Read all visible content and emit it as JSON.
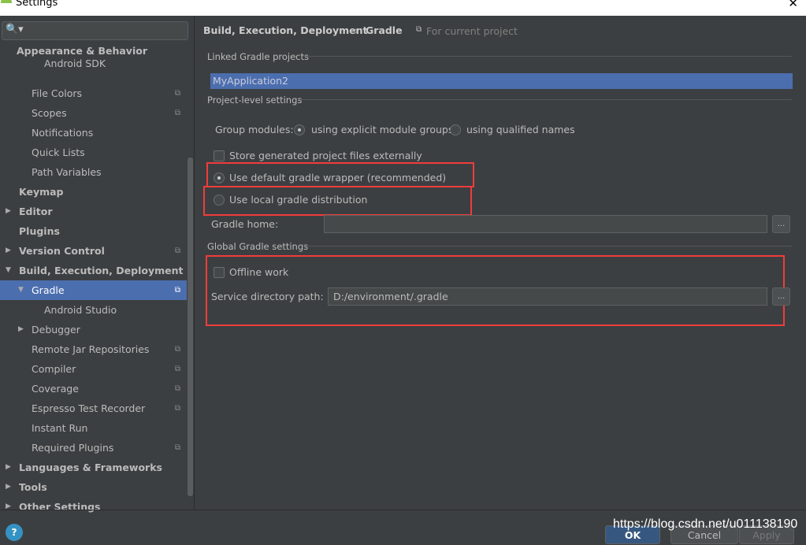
{
  "window": {
    "title": "Settings",
    "close": "✕"
  },
  "search": {
    "icon": "search-icon",
    "glyph": "🔍▾"
  },
  "sidebar": {
    "items": [
      {
        "label": "Appearance & Behavior",
        "level": 0,
        "bold": true
      },
      {
        "label": "Android SDK",
        "level": 2
      },
      {
        "label": "File Colors",
        "level": 1,
        "copy": true
      },
      {
        "label": "Scopes",
        "level": 1,
        "copy": true
      },
      {
        "label": "Notifications",
        "level": 1
      },
      {
        "label": "Quick Lists",
        "level": 1
      },
      {
        "label": "Path Variables",
        "level": 1
      },
      {
        "label": "Keymap",
        "level": 0,
        "bold": true
      },
      {
        "label": "Editor",
        "level": 0,
        "bold": true,
        "arrow": "▶"
      },
      {
        "label": "Plugins",
        "level": 0,
        "bold": true
      },
      {
        "label": "Version Control",
        "level": 0,
        "bold": true,
        "arrow": "▶",
        "copy": true
      },
      {
        "label": "Build, Execution, Deployment",
        "level": 0,
        "bold": true,
        "arrow": "▼"
      },
      {
        "label": "Gradle",
        "level": 1,
        "arrow": "▼",
        "copy": true,
        "selected": true
      },
      {
        "label": "Android Studio",
        "level": 2
      },
      {
        "label": "Debugger",
        "level": 1,
        "arrow": "▶"
      },
      {
        "label": "Remote Jar Repositories",
        "level": 1,
        "copy": true
      },
      {
        "label": "Compiler",
        "level": 1,
        "copy": true
      },
      {
        "label": "Coverage",
        "level": 1,
        "copy": true
      },
      {
        "label": "Espresso Test Recorder",
        "level": 1,
        "copy": true
      },
      {
        "label": "Instant Run",
        "level": 1
      },
      {
        "label": "Required Plugins",
        "level": 1,
        "copy": true
      },
      {
        "label": "Languages & Frameworks",
        "level": 0,
        "bold": true,
        "arrow": "▶"
      },
      {
        "label": "Tools",
        "level": 0,
        "bold": true,
        "arrow": "▶"
      },
      {
        "label": "Other Settings",
        "level": 0,
        "bold": true,
        "arrow": "▶"
      }
    ]
  },
  "breadcrumb": {
    "parent": "Build, Execution, Deployment",
    "sep": "›",
    "current": "Gradle",
    "scope": "For current project"
  },
  "linked": {
    "title": "Linked Gradle projects",
    "project": "MyApplication2"
  },
  "project_level": {
    "title": "Project-level settings",
    "group_modules": "Group modules:",
    "opt_explicit": "using explicit module groups",
    "opt_qualified": "using qualified names",
    "selected": "explicit",
    "store_external": "Store generated project files externally",
    "store_external_checked": false,
    "use_wrapper": "Use default gradle wrapper (recommended)",
    "use_local": "Use local gradle distribution",
    "distribution": "wrapper",
    "gradle_home_label": "Gradle home:",
    "gradle_home_value": "",
    "browse": "..."
  },
  "global": {
    "title": "Global Gradle settings",
    "offline": "Offline work",
    "offline_checked": false,
    "service_label": "Service directory path:",
    "service_value": "D:/environment/.gradle",
    "browse": "..."
  },
  "footer": {
    "help": "?",
    "ok": "OK",
    "cancel": "Cancel",
    "apply": "Apply",
    "watermark": "https://blog.csdn.net/u011138190"
  },
  "colors": {
    "selection": "#4b6eaf",
    "highlight": "#f03c3c",
    "background": "#3c3f41"
  }
}
